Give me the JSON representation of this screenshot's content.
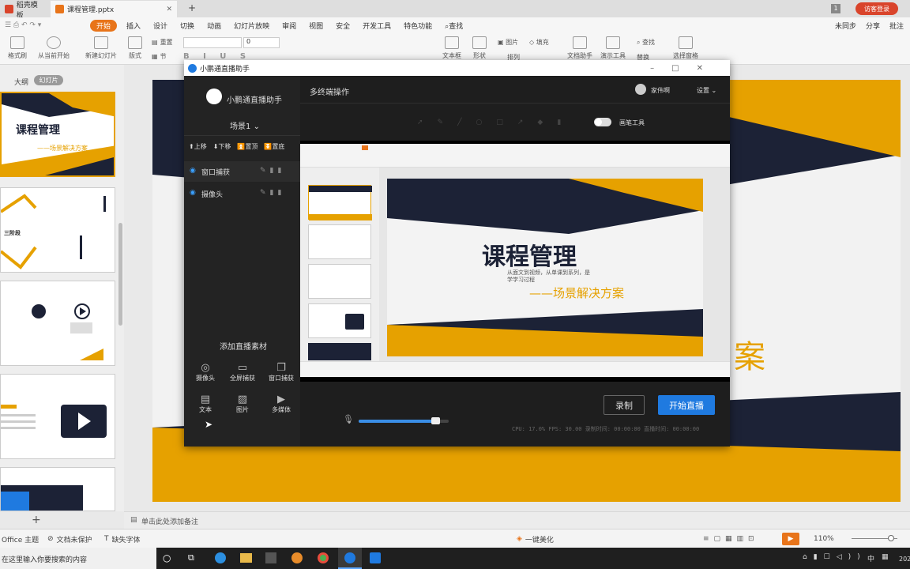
{
  "titlebar": {
    "tab1": "稻壳模板",
    "tab2": "课程管理.pptx",
    "new_tab": "+",
    "page_count": "1",
    "login": "访客登录"
  },
  "menu": {
    "file_label": "文件",
    "items": [
      "开始",
      "插入",
      "设计",
      "切换",
      "动画",
      "幻灯片放映",
      "审阅",
      "视图",
      "安全",
      "开发工具",
      "特色功能",
      "查找"
    ],
    "right": [
      "未同步",
      "分享",
      "批注"
    ]
  },
  "toolbar": {
    "items": [
      "格式刷",
      "从当前开始",
      "新建幻灯片",
      "版式",
      "节",
      "重置",
      "文本框",
      "形状",
      "排列",
      "文档助手",
      "演示工具",
      "替换",
      "选择窗格"
    ],
    "font_size": "0",
    "picture": "图片",
    "fill": "填充",
    "find": "查找"
  },
  "leftpane": {
    "tab_outline": "大纲",
    "tab_slides": "幻灯片",
    "add": "+",
    "slide1_title": "课程管理",
    "slide1_sub": "——场景解决方案",
    "slide2_text": "三阶段"
  },
  "slide": {
    "big_char": "案"
  },
  "dialog": {
    "title": "小鹏通直播助手",
    "app_name": "小鹏通直播助手",
    "scene": "场景1",
    "actions": [
      "上移",
      "下移",
      "置顶",
      "置底"
    ],
    "sources": [
      "窗口捕获",
      "摄像头"
    ],
    "add_title": "添加直播素材",
    "materials": [
      "摄像头",
      "全屏捕获",
      "窗口捕获",
      "文本",
      "图片",
      "多媒体"
    ],
    "header_title": "多终端操作",
    "user_name": "家伟啊",
    "settings": "设置",
    "brush_tool": "画笔工具",
    "record": "录制",
    "go_live": "开始直播",
    "stats": "CPU: 17.0%  FPS: 30.00  录制时间: 00:00:00  直播时间: 00:00:00",
    "preview_title": "课程管理",
    "preview_sub1": "从面文到视频，从单课到系列，是",
    "preview_sub2": "学学习过程",
    "preview_scene": "——场景解决方案",
    "volume": 0.85
  },
  "notes": {
    "placeholder": "单击此处添加备注"
  },
  "status": {
    "theme": "Office 主题",
    "protect": "文档未保护",
    "font": "缺失字体",
    "beautify": "一键美化",
    "zoom": "110%"
  },
  "taskbar": {
    "search": "在这里输入你要搜索的内容",
    "ime": "中",
    "date": "202"
  },
  "colors": {
    "accent": "#e6a100",
    "brand": "#e8741a",
    "live": "#1f7ae0",
    "navy": "#1c2236"
  }
}
